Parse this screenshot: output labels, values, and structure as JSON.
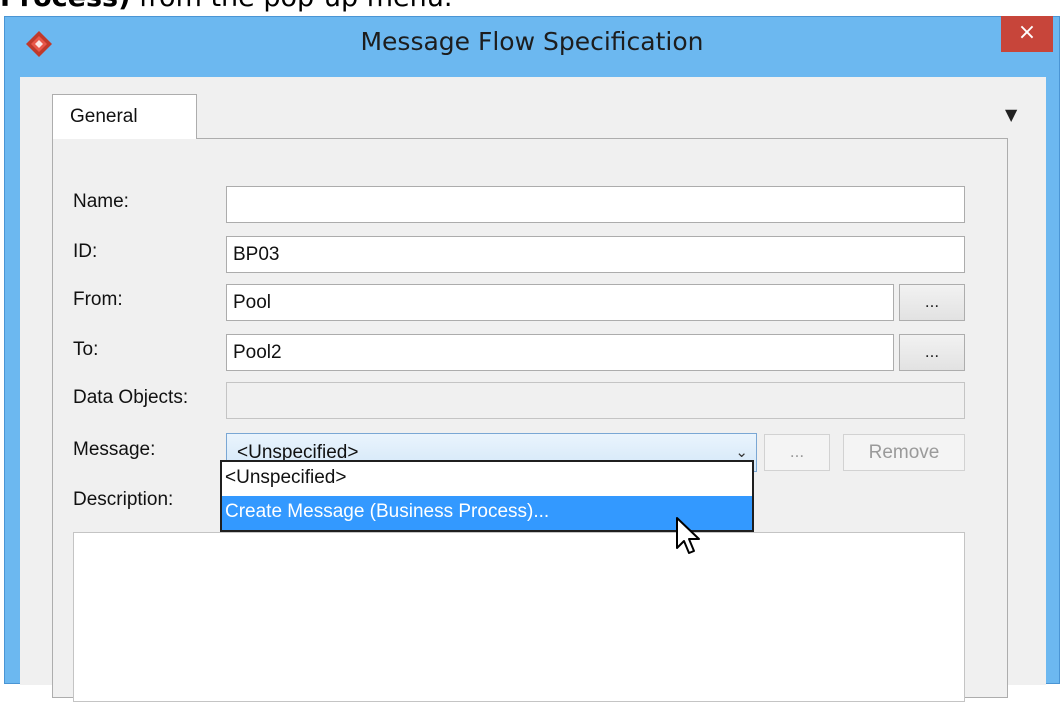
{
  "caption": {
    "bold": "Process)",
    "rest": " from the pop-up menu."
  },
  "window": {
    "title": "Message Flow Specification",
    "close_label": "×",
    "overflow_glyph": "▼"
  },
  "tabs": [
    {
      "label": "General"
    }
  ],
  "form": {
    "name": {
      "label": "Name:",
      "value": ""
    },
    "id": {
      "label": "ID:",
      "value": "BP03"
    },
    "from": {
      "label": "From:",
      "value": "Pool",
      "button_label": "..."
    },
    "to": {
      "label": "To:",
      "value": "Pool2",
      "button_label": "..."
    },
    "data_objects": {
      "label": "Data Objects:",
      "value": ""
    },
    "message": {
      "label": "Message:",
      "selected": "<Unspecified>",
      "chevron": "⌄",
      "dots_label": "...",
      "remove_label": "Remove"
    },
    "description": {
      "label": "Description:"
    }
  },
  "popup": {
    "items": [
      {
        "label": "<Unspecified>"
      },
      {
        "label": "Create Message (Business Process)..."
      }
    ]
  },
  "colors": {
    "titlebar": "#6cb8f0",
    "close": "#c7453a",
    "highlight": "#3399ff",
    "app_icon": "#c0392b"
  },
  "icons": {
    "app": "diamond-logo-icon",
    "cursor": "mouse-pointer-icon"
  }
}
